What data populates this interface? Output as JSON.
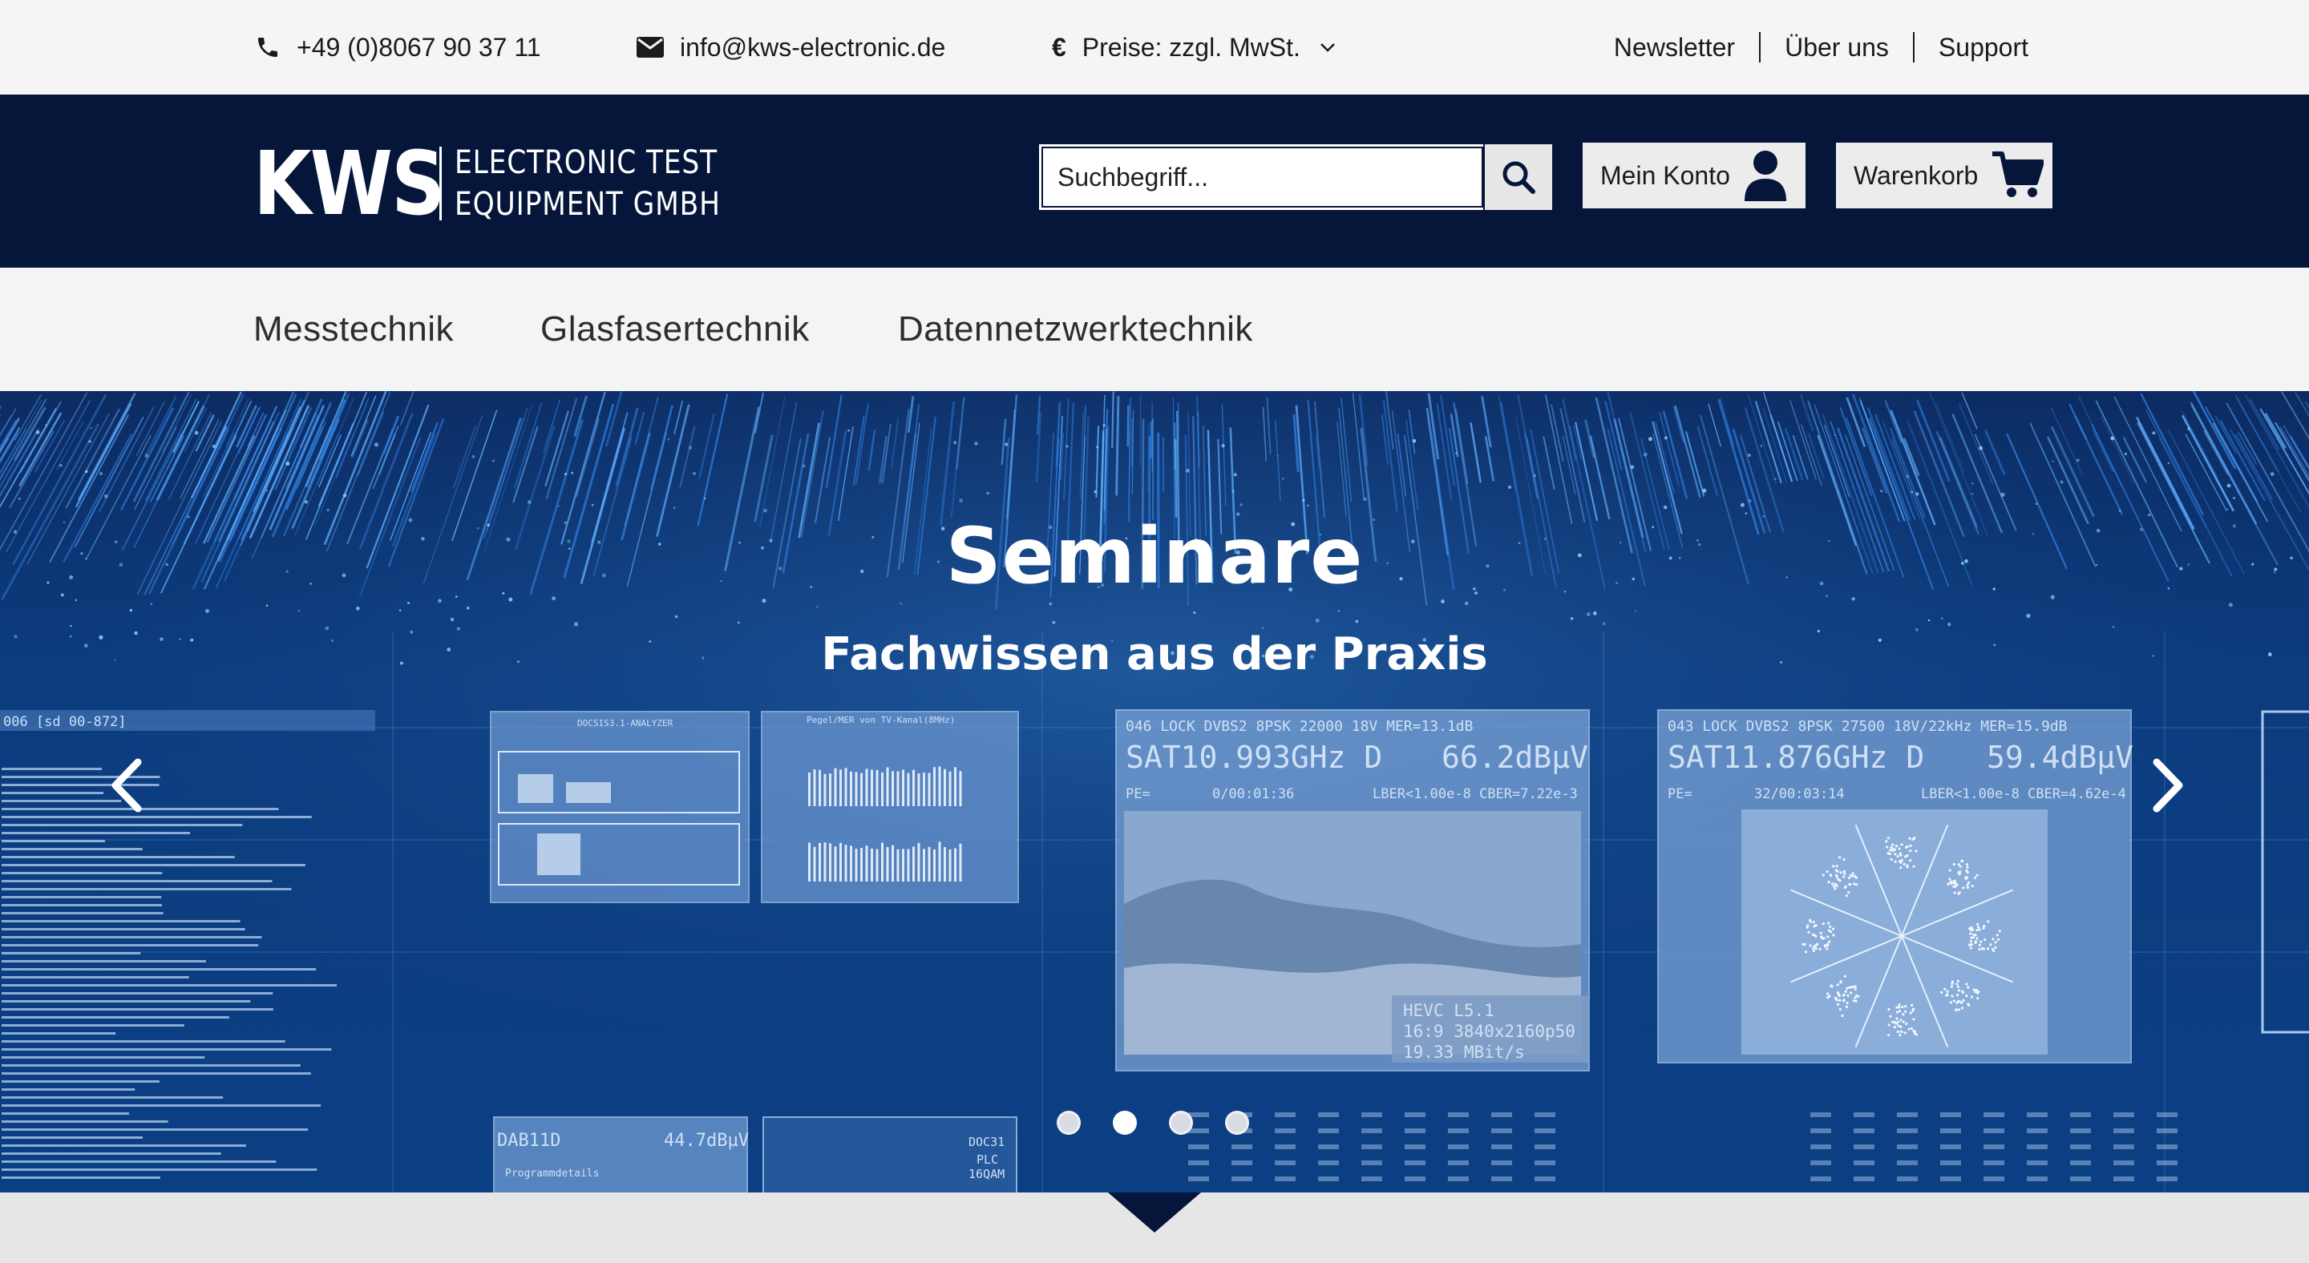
{
  "topbar": {
    "phone": "+49 (0)8067 90 37 11",
    "email": "info@kws-electronic.de",
    "price_label": "Preise: zzgl. MwSt.",
    "currency_symbol": "€",
    "links": [
      "Newsletter",
      "Über uns",
      "Support"
    ]
  },
  "header": {
    "logo_main": "KWS",
    "logo_line1": "ELECTRONIC TEST",
    "logo_line2": "EQUIPMENT GMBH",
    "search_placeholder": "Suchbegriff...",
    "account_label": "Mein Konto",
    "cart_label": "Warenkorb"
  },
  "nav": {
    "items": [
      "Messtechnik",
      "Glasfasertechnik",
      "Datennetzwerktechnik"
    ]
  },
  "hero": {
    "title": "Seminare",
    "subtitle": "Fachwissen aus der Praxis",
    "slide_count": 4,
    "active_slide": 2,
    "screens": {
      "left_header": "006 [sd 00-872]",
      "analyzer_title": "DOCSIS3.1-ANALYZER",
      "pegel_title": "Pegel/MER von TV-Kanal(8MHz)",
      "sat1_status": "046 LOCK  DVBS2 8PSK 22000    18V     MER=13.1dB",
      "sat1_freq": "SAT10.993GHz  D",
      "sat1_level": "66.2dBµV",
      "sat1_pe": "PE=",
      "sat1_time": "0/00:01:36",
      "sat1_ber": "LBER<1.00e-8 CBER=7.22e-3",
      "sat1_hevc": "HEVC      L5.1",
      "sat1_res": "16:9   3840x2160p50",
      "sat1_rate": "19.33 MBit/s",
      "sat2_status": "043 LOCK  DVBS2 8PSK 27500  18V/22kHz MER=15.9dB",
      "sat2_freq": "SAT11.876GHz  D",
      "sat2_level": "59.4dBµV",
      "sat2_pe": "PE=",
      "sat2_time": "32/00:03:14",
      "sat2_ber": "LBER<1.00e-8 CBER=4.62e-4",
      "dab_label": "DAB11D",
      "dab_level": "44.7dBµV",
      "dab_prog": "Programmdetails",
      "doc_label1": "DOC31",
      "doc_label2": "PLC",
      "doc_label3": "16QAM"
    }
  },
  "colors": {
    "header_bg": "#06153a",
    "hero_bg": "#0a3878",
    "topbar_bg": "#f5f5f5"
  },
  "icons": [
    "phone-icon",
    "envelope-icon",
    "chevron-down-icon",
    "search-icon",
    "user-icon",
    "cart-icon",
    "chevron-left-icon",
    "chevron-right-icon"
  ]
}
